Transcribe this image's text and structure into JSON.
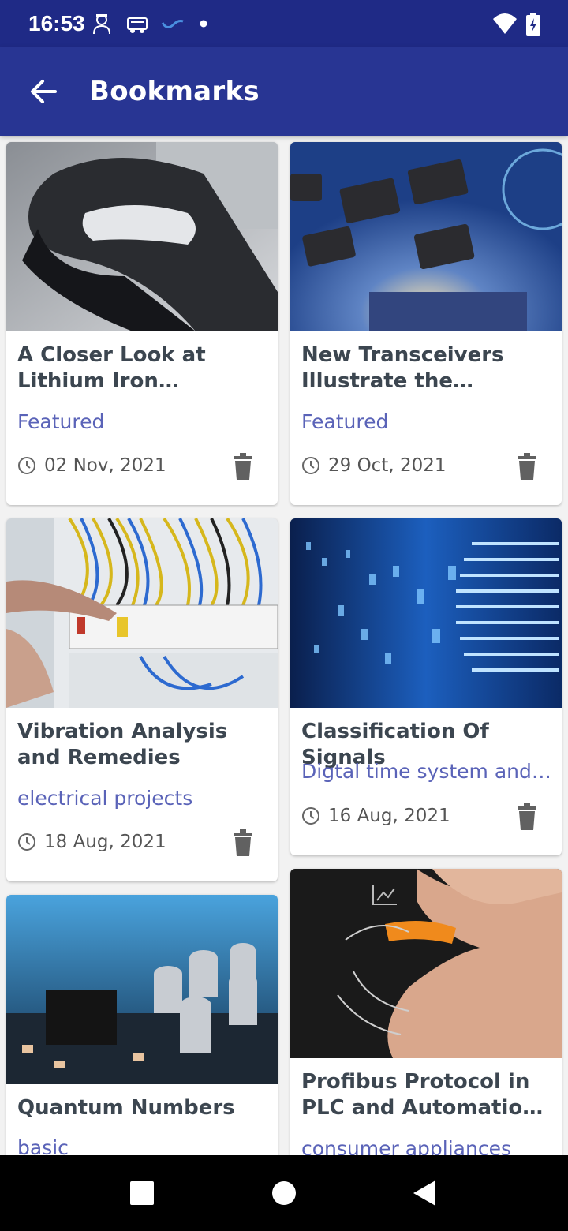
{
  "status_bar": {
    "time": "16:53"
  },
  "app_bar": {
    "title": "Bookmarks"
  },
  "colors": {
    "status_bar": "#1f2a86",
    "app_bar": "#283593",
    "category": "#5a63b8",
    "title": "#3c4650"
  },
  "bookmarks": [
    {
      "title": "A Closer Look at Lithium Iron Phosphate Batteries",
      "category": "Featured",
      "date": "02 Nov, 2021"
    },
    {
      "title": "New Transceivers Illustrate the Importance",
      "category": "Featured",
      "date": "29 Oct, 2021"
    },
    {
      "title": "Vibration Analysis and Remedies",
      "category": "electrical projects",
      "date": "18 Aug, 2021"
    },
    {
      "title": "Classification Of Signals",
      "category": "Digtal time system and signals",
      "date": "16 Aug, 2021"
    },
    {
      "title": "Quantum Numbers",
      "category": "basic",
      "date": ""
    },
    {
      "title": "Profibus Protocol in PLC and Automation Technology",
      "category": "consumer appliances",
      "date": ""
    }
  ],
  "icons": {
    "back": "arrow-back-icon",
    "clock": "clock-icon",
    "delete": "trash-icon"
  }
}
